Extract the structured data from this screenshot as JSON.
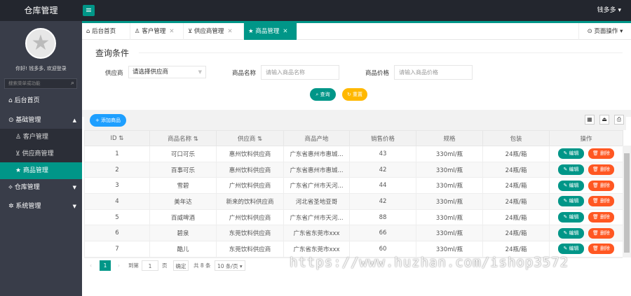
{
  "header": {
    "title": "仓库管理",
    "menu_icon": "≡",
    "user": "钱多多 ▾"
  },
  "sidebar": {
    "greeting": "你好! 钱多多, 欢迎登录",
    "search_placeholder": "搜索菜单或功能",
    "items": [
      {
        "label": "⌂ 后台首页"
      },
      {
        "label": "⊙ 基础管理",
        "arrow": "▲"
      },
      {
        "label": "♙ 客户管理"
      },
      {
        "label": "⊻ 供应商管理"
      },
      {
        "label": "★ 商品管理"
      },
      {
        "label": "⟡ 仓库管理",
        "arrow": "▼"
      },
      {
        "label": "✲ 系统管理",
        "arrow": "▼"
      }
    ]
  },
  "tabs": [
    {
      "label": "⌂ 后台首页"
    },
    {
      "label": "♙ 客户管理",
      "close": "✕"
    },
    {
      "label": "⊻ 供应商管理",
      "close": "✕"
    },
    {
      "label": "★ 商品管理",
      "close": "✕"
    }
  ],
  "page_operation": "⊙ 页面操作 ▾",
  "query": {
    "title": "查询条件",
    "supplier_label": "供应商",
    "supplier_value": "请选择供应商",
    "name_label": "商品名称",
    "name_placeholder": "请输入商品名称",
    "price_label": "商品价格",
    "price_placeholder": "请输入商品价格",
    "query_btn": "⌕ 查询",
    "reset_btn": "↻ 重置"
  },
  "toolbar": {
    "add_btn": "+ 添加商品"
  },
  "table": {
    "headers": [
      "ID ⇅",
      "商品名称 ⇅",
      "供应商 ⇅",
      "商品产地",
      "销售价格",
      "规格",
      "包装",
      "操作"
    ],
    "edit_label": "✎ 编辑",
    "delete_label": "🗑 删除",
    "rows": [
      [
        "1",
        "可口可乐",
        "惠州饮料供应商",
        "广东省惠州市惠城...",
        "43",
        "330ml/瓶",
        "24瓶/箱"
      ],
      [
        "2",
        "百事可乐",
        "惠州饮料供应商",
        "广东省惠州市惠城...",
        "42",
        "330ml/瓶",
        "24瓶/箱"
      ],
      [
        "3",
        "雪碧",
        "广州饮料供应商",
        "广东省广州市天河...",
        "44",
        "330ml/瓶",
        "24瓶/箱"
      ],
      [
        "4",
        "美年达",
        "新来的饮料供应商",
        "河北省圣地亚哥",
        "42",
        "330ml/瓶",
        "24瓶/箱"
      ],
      [
        "5",
        "百威啤酒",
        "广州饮料供应商",
        "广东省广州市天河...",
        "88",
        "330ml/瓶",
        "24瓶/箱"
      ],
      [
        "6",
        "碧泉",
        "东莞饮料供应商",
        "广东省东莞市xxx",
        "66",
        "330ml/瓶",
        "24瓶/箱"
      ],
      [
        "7",
        "酷儿",
        "东莞饮料供应商",
        "广东省东莞市xxx",
        "60",
        "330ml/瓶",
        "24瓶/箱"
      ]
    ]
  },
  "pager": {
    "prev": "‹",
    "page": "1",
    "next": "›",
    "goto": "到第",
    "page_input": "1",
    "page_unit": "页",
    "confirm": "确定",
    "total": "共 8 条",
    "per_page": "10 条/页 ▾"
  },
  "watermark": "https://www.huzhan.com/ishop3572"
}
